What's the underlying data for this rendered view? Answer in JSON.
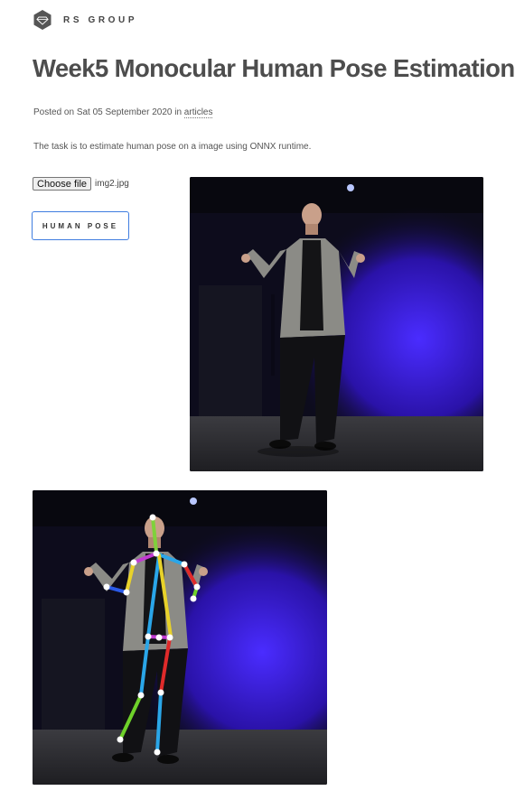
{
  "brand": {
    "name": "RS GROUP",
    "icon": "diamond-hexagon-icon"
  },
  "post": {
    "title": "Week5 Monocular Human Pose Estimation",
    "meta_prefix": "Posted on Sat 05 September 2020 in ",
    "category": "articles",
    "description": "The task is to estimate human pose on a image using ONNX runtime."
  },
  "upload": {
    "button_label": "Choose file",
    "file_name": "img2.jpg"
  },
  "action": {
    "button_label": "HUMAN POSE"
  },
  "colors": {
    "accent": "#3f7de0",
    "stage_blue": "#3a1fd6",
    "title": "#4d4d4d"
  },
  "skeleton_colors": {
    "head": "#7fd13b",
    "shoulders": "#c13bd1",
    "left_arm": "#e8d22a",
    "right_arm": "#e02a2a",
    "torso": "#2aa6e8",
    "legs_green": "#6ed12a",
    "legs_red": "#e02a2a"
  }
}
